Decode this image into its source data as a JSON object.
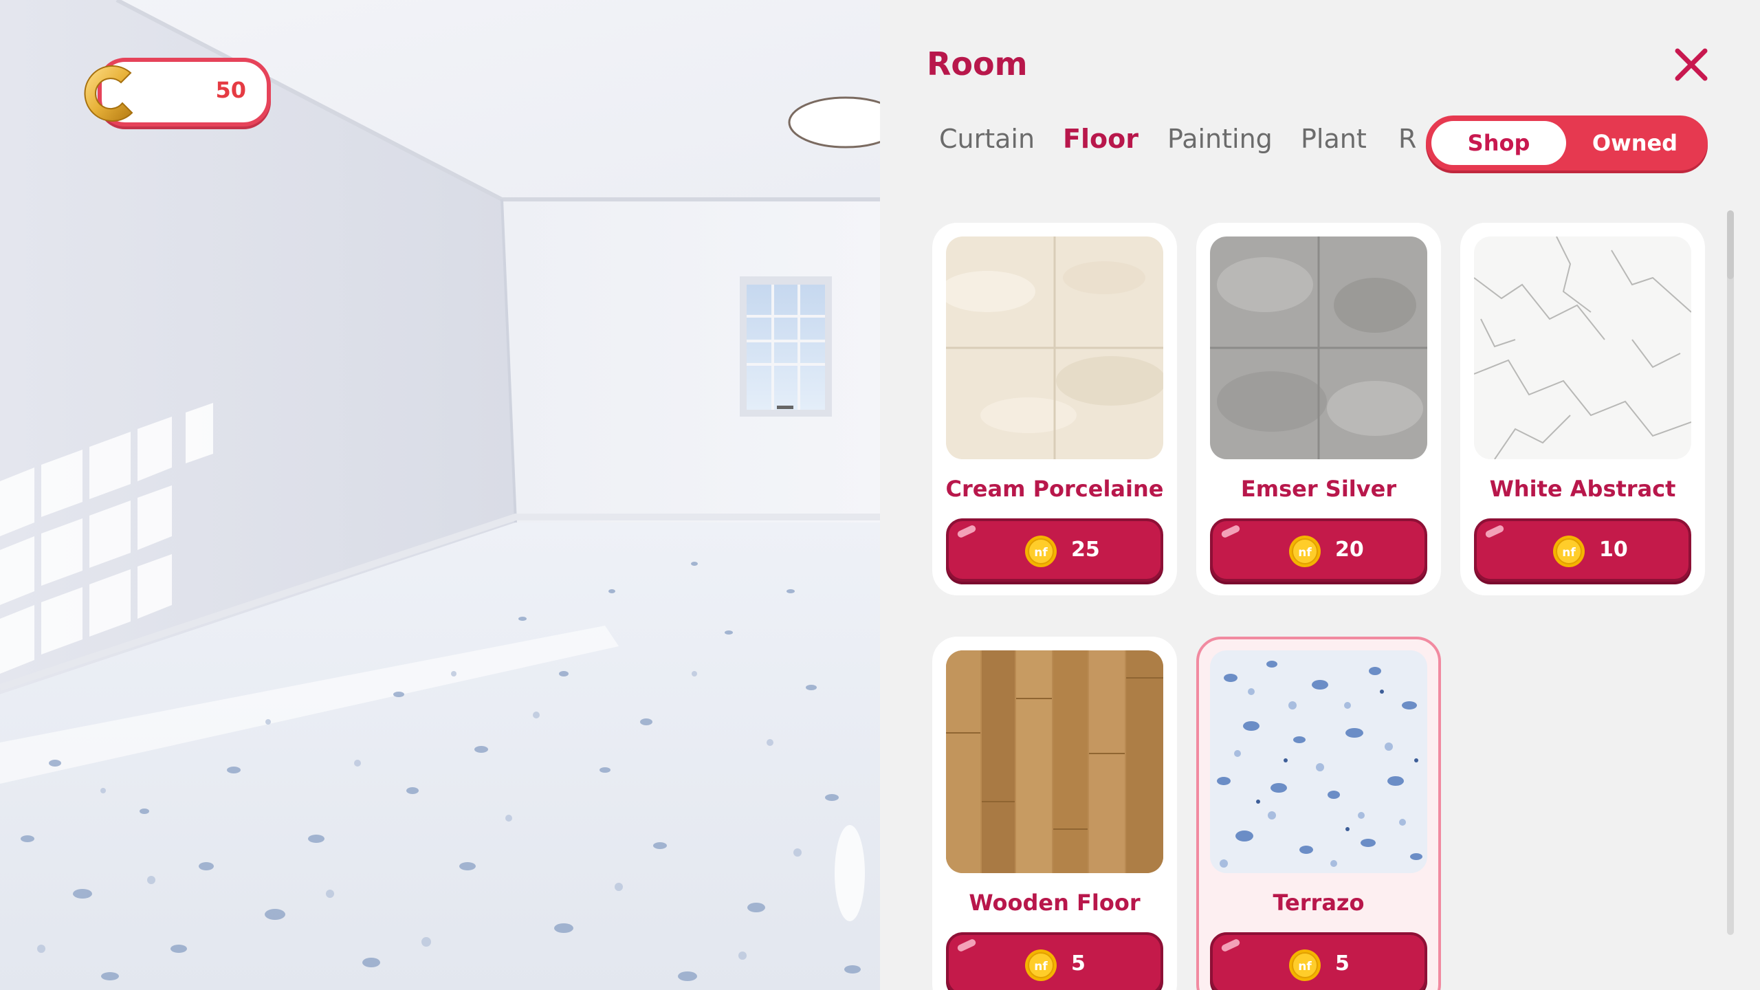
{
  "hud": {
    "coin_balance": "50"
  },
  "panel": {
    "title": "Room",
    "tabs": [
      "Curtain",
      "Floor",
      "Painting",
      "Plant",
      "R"
    ],
    "active_tab": "Floor",
    "toggle": {
      "shop_label": "Shop",
      "owned_label": "Owned",
      "selected": "Shop"
    }
  },
  "items": [
    {
      "name": "Cream Porcelaine",
      "price": "25",
      "texture": "cream-porcelain"
    },
    {
      "name": "Emser Silver",
      "price": "20",
      "texture": "grey-marble"
    },
    {
      "name": "White Abstract",
      "price": "10",
      "texture": "white-marble"
    },
    {
      "name": "Wooden Floor",
      "price": "5",
      "texture": "wood"
    },
    {
      "name": "Terrazo",
      "price": "5",
      "texture": "terrazzo",
      "selected": true
    }
  ],
  "colors": {
    "accent": "#b8174b",
    "button": "#c41a4a",
    "toggle": "#e63950",
    "coin": "#f5b400"
  }
}
